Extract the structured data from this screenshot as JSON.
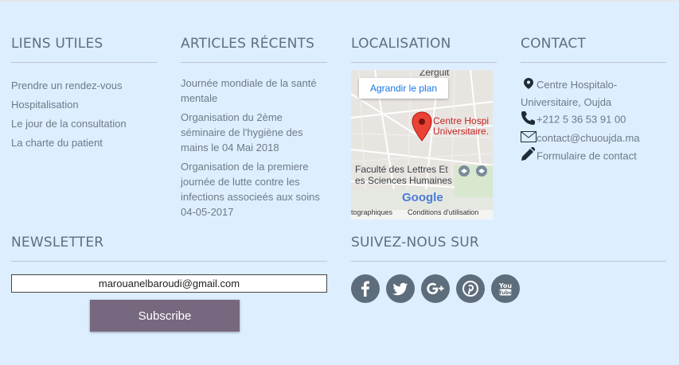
{
  "liens": {
    "title": "LIENS UTILES",
    "items": [
      {
        "label": "Prendre un rendez-vous"
      },
      {
        "label": "Hospitalisation"
      },
      {
        "label": "Le jour de la consultation"
      },
      {
        "label": "La charte du patient"
      }
    ]
  },
  "articles": {
    "title": "ARTICLES RÉCENTS",
    "items": [
      {
        "label": "Journée mondiale de la santé mentale"
      },
      {
        "label": "Organisation du 2ème séminaire de l'hygiène des mains le 04 Mai 2018"
      },
      {
        "label": "Organisation de la premiere journée de lutte contre les infections associeés aux soins 04-05-2017"
      }
    ]
  },
  "localisation": {
    "title": "LOCALISATION",
    "enlarge_label": "Agrandir le plan",
    "place_top": "Zerguit",
    "marker_label": "Centre Hospi Universitaire...",
    "marker_line1": "Centre Hospi",
    "marker_line2": "Universitaire.",
    "faculty_line1": "Faculté des Lettres Et",
    "faculty_line2": "es Sciences Humaines",
    "google_label": "Google",
    "footer_left": "tographiques",
    "footer_right": "Conditions d'utilisation"
  },
  "contact": {
    "title": "CONTACT",
    "address": "Centre Hospitalo-Universitaire, Oujda",
    "phone": "+212 5 36 53 91 00",
    "email": "contact@chuoujda.ma",
    "form": "Formulaire de contact"
  },
  "newsletter": {
    "title": "NEWSLETTER",
    "email_value": "marouanelbaroudi@gmail.com",
    "subscribe_label": "Subscribe"
  },
  "follow": {
    "title": "SUIVEZ-NOUS SUR",
    "networks": [
      "facebook-icon",
      "twitter-icon",
      "google-plus-icon",
      "pinterest-icon",
      "youtube-icon"
    ]
  },
  "colors": {
    "background": "#ddeeff",
    "heading": "#5d6f80",
    "button": "#76687e",
    "social": "#5e6d7b",
    "map_pin": "#ea4335"
  }
}
